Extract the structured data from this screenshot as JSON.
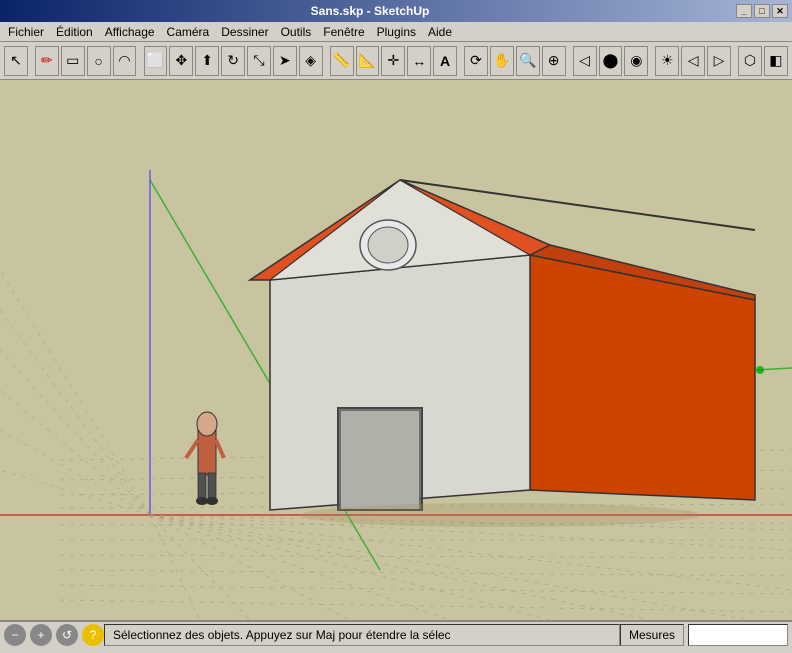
{
  "titleBar": {
    "title": "Sans.skp - SketchUp",
    "minimizeLabel": "_",
    "maximizeLabel": "□",
    "closeLabel": "✕"
  },
  "menuBar": {
    "items": [
      "Fichier",
      "Édition",
      "Affichage",
      "Caméra",
      "Dessiner",
      "Outils",
      "Fenêtre",
      "Plugins",
      "Aide"
    ]
  },
  "toolbar": {
    "tools": [
      {
        "name": "select",
        "icon": "↖"
      },
      {
        "name": "pencil",
        "icon": "✏"
      },
      {
        "name": "rectangle",
        "icon": "▭"
      },
      {
        "name": "circle",
        "icon": "○"
      },
      {
        "name": "arc",
        "icon": "◠"
      },
      {
        "name": "eraser",
        "icon": "⬜"
      },
      {
        "name": "move",
        "icon": "✥"
      },
      {
        "name": "pushpull",
        "icon": "⬆"
      },
      {
        "name": "rotate",
        "icon": "↻"
      },
      {
        "name": "scale",
        "icon": "⤡"
      },
      {
        "name": "followme",
        "icon": "➤"
      },
      {
        "name": "offset",
        "icon": "◈"
      },
      {
        "name": "tape",
        "icon": "📏"
      },
      {
        "name": "protractor",
        "icon": "📐"
      },
      {
        "name": "axes",
        "icon": "✛"
      },
      {
        "name": "dimensions",
        "icon": "↔"
      },
      {
        "name": "text",
        "icon": "A"
      },
      {
        "name": "orbit",
        "icon": "⟳"
      },
      {
        "name": "pan",
        "icon": "✋"
      },
      {
        "name": "zoom",
        "icon": "🔍"
      },
      {
        "name": "zoomext",
        "icon": "⊕"
      },
      {
        "name": "previous",
        "icon": "◀"
      },
      {
        "name": "walkthrough",
        "icon": "⬤"
      },
      {
        "name": "lookaround",
        "icon": "◉"
      },
      {
        "name": "shadow",
        "icon": "☀"
      },
      {
        "name": "back",
        "icon": "◁"
      },
      {
        "name": "forward",
        "icon": "▷"
      },
      {
        "name": "components",
        "icon": "⬡"
      },
      {
        "name": "materials",
        "icon": "◧"
      }
    ]
  },
  "statusBar": {
    "statusText": "Sélectionnez des objets. Appuyez sur Maj pour étendre la sélec",
    "mesuresLabel": "Mesures",
    "icons": [
      {
        "name": "minus",
        "color": "gray",
        "icon": "−"
      },
      {
        "name": "plus",
        "color": "gray",
        "icon": "+"
      },
      {
        "name": "refresh",
        "color": "gray",
        "icon": "↺"
      },
      {
        "name": "help",
        "color": "yellow",
        "icon": "?"
      }
    ]
  }
}
